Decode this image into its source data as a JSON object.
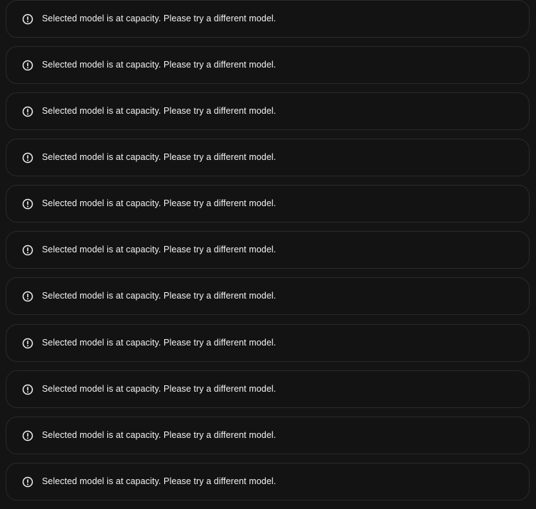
{
  "toasts": [
    {
      "icon": "alert-circle-icon",
      "message": "Selected model is at capacity. Please try a different model."
    },
    {
      "icon": "alert-circle-icon",
      "message": "Selected model is at capacity. Please try a different model."
    },
    {
      "icon": "alert-circle-icon",
      "message": "Selected model is at capacity. Please try a different model."
    },
    {
      "icon": "alert-circle-icon",
      "message": "Selected model is at capacity. Please try a different model."
    },
    {
      "icon": "alert-circle-icon",
      "message": "Selected model is at capacity. Please try a different model."
    },
    {
      "icon": "alert-circle-icon",
      "message": "Selected model is at capacity. Please try a different model."
    },
    {
      "icon": "alert-circle-icon",
      "message": "Selected model is at capacity. Please try a different model."
    },
    {
      "icon": "alert-circle-icon",
      "message": "Selected model is at capacity. Please try a different model."
    },
    {
      "icon": "alert-circle-icon",
      "message": "Selected model is at capacity. Please try a different model."
    },
    {
      "icon": "alert-circle-icon",
      "message": "Selected model is at capacity. Please try a different model."
    },
    {
      "icon": "alert-circle-icon",
      "message": "Selected model is at capacity. Please try a different model."
    }
  ],
  "colors": {
    "background": "#141414",
    "toast_background": "#131313",
    "toast_border": "#2a2a2a",
    "text": "#f3f3f3"
  }
}
